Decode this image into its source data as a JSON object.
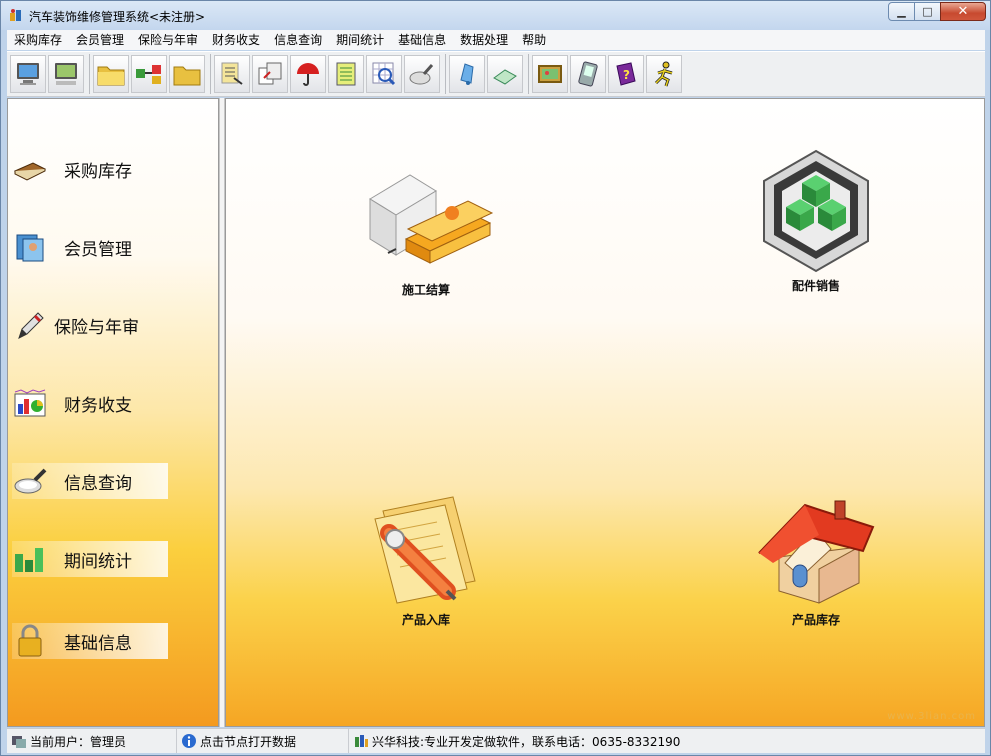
{
  "window": {
    "title": "汽车装饰维修管理系统<未注册>"
  },
  "menu": [
    "采购库存",
    "会员管理",
    "保险与年审",
    "财务收支",
    "信息查询",
    "期间统计",
    "基础信息",
    "数据处理",
    "帮助"
  ],
  "sidebar": {
    "items": [
      {
        "label": "采购库存",
        "icon": "book-icon"
      },
      {
        "label": "会员管理",
        "icon": "member-card-icon"
      },
      {
        "label": "保险与年审",
        "icon": "pen-icon"
      },
      {
        "label": "财务收支",
        "icon": "finance-chart-icon"
      },
      {
        "label": "信息查询",
        "icon": "magnifier-icon"
      },
      {
        "label": "期间统计",
        "icon": "bar-chart-icon"
      },
      {
        "label": "基础信息",
        "icon": "lock-icon"
      }
    ]
  },
  "tiles": [
    {
      "label": "施工结算",
      "icon": "money-icon"
    },
    {
      "label": "配件销售",
      "icon": "cubes-icon"
    },
    {
      "label": "产品入库",
      "icon": "document-pen-icon"
    },
    {
      "label": "产品库存",
      "icon": "house-icon"
    }
  ],
  "status": {
    "user": "当前用户：管理员",
    "hint": "点击节点打开数据",
    "company": "兴华科技:专业开发定做软件，联系电话：0635-8332190"
  },
  "watermark": "www.3lian.com"
}
